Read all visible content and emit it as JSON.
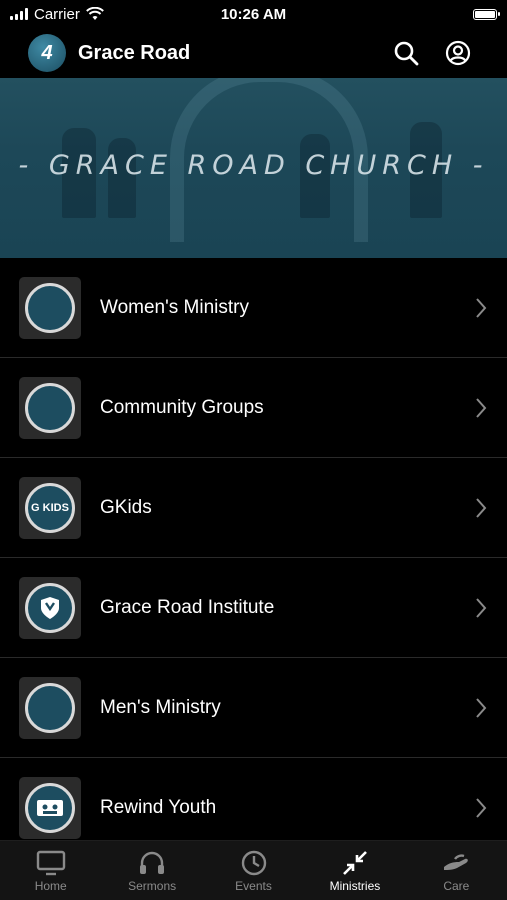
{
  "status_bar": {
    "carrier": "Carrier",
    "time": "10:26 AM",
    "battery_level": 1.0
  },
  "header": {
    "logo_text": "4",
    "title": "Grace Road"
  },
  "hero": {
    "title": "- GRACE ROAD CHURCH -"
  },
  "ministries": [
    {
      "label": "Women's Ministry",
      "thumb_text": ""
    },
    {
      "label": "Community Groups",
      "thumb_text": ""
    },
    {
      "label": "GKids",
      "thumb_text": "G KIDS"
    },
    {
      "label": "Grace Road Institute",
      "thumb_text": ""
    },
    {
      "label": "Men's Ministry",
      "thumb_text": ""
    },
    {
      "label": "Rewind Youth",
      "thumb_text": ""
    }
  ],
  "tabs": [
    {
      "label": "Home",
      "icon": "tv-icon"
    },
    {
      "label": "Sermons",
      "icon": "headphones-icon"
    },
    {
      "label": "Events",
      "icon": "clock-icon"
    },
    {
      "label": "Ministries",
      "icon": "compress-icon"
    },
    {
      "label": "Care",
      "icon": "hand-icon"
    }
  ],
  "active_tab": "Ministries",
  "colors": {
    "accent": "#1d4d60",
    "background": "#000000",
    "tab_bar": "#141414",
    "inactive_label": "#8a8a8a"
  }
}
